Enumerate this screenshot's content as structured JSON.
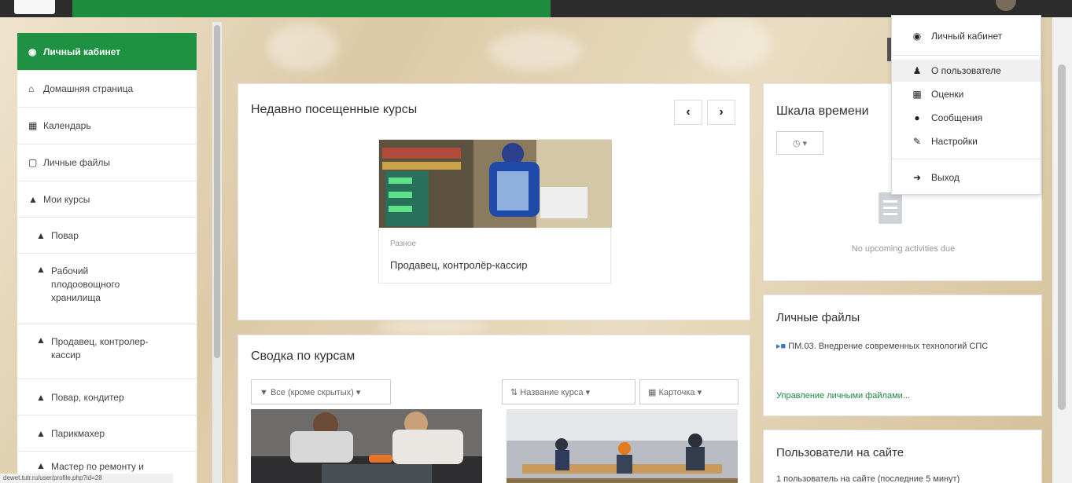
{
  "sidebar": {
    "items": [
      {
        "label": "Личный кабинет",
        "icon": "dashboard-icon",
        "active": true
      },
      {
        "label": "Домашняя страница",
        "icon": "home-icon"
      },
      {
        "label": "Календарь",
        "icon": "calendar-icon"
      },
      {
        "label": "Личные файлы",
        "icon": "file-icon"
      },
      {
        "label": "Мои курсы",
        "icon": "graduation-cap-icon"
      },
      {
        "label": "Повар",
        "icon": "graduation-cap-icon"
      },
      {
        "label": "Рабочий плодоовощного хранилища",
        "icon": "graduation-cap-icon"
      },
      {
        "label": "Продавец, контролер-кассир",
        "icon": "graduation-cap-icon"
      },
      {
        "label": "Повар, кондитер",
        "icon": "graduation-cap-icon"
      },
      {
        "label": "Парикмахер",
        "icon": "graduation-cap-icon"
      },
      {
        "label": "Мастер по ремонту и",
        "icon": "graduation-cap-icon"
      }
    ],
    "status_url": "dewet.tutr.ru/user/profile.php?id=28"
  },
  "recent": {
    "title": "Недавно посещенные курсы",
    "prev_icon": "chevron-left-icon",
    "next_icon": "chevron-right-icon",
    "course": {
      "category": "Разное",
      "name": "Продавец, контролёр-кассир"
    }
  },
  "overview": {
    "title": "Сводка по курсам",
    "filter_label": "▼ Все (кроме скрытых) ▾",
    "sort_label": "⇅ Название курса ▾",
    "view_label": "▦ Карточка ▾"
  },
  "timeline": {
    "title": "Шкала времени",
    "select_label": "◷ ▾",
    "empty_text": "No upcoming activities due"
  },
  "files": {
    "title": "Личные файлы",
    "entry": "ПМ.03. Внедрение современных технологий СПС",
    "manage_link": "Управление личными файлами..."
  },
  "online": {
    "title": "Пользователи на сайте",
    "text": "1 пользователь на сайте (последние 5 минут)"
  },
  "user_menu": {
    "items": [
      {
        "label": "Личный кабинет",
        "icon": "dashboard-icon"
      },
      {
        "label": "О пользователе",
        "icon": "user-icon"
      },
      {
        "label": "Оценки",
        "icon": "table-icon"
      },
      {
        "label": "Сообщения",
        "icon": "comment-icon"
      },
      {
        "label": "Настройки",
        "icon": "wrench-icon"
      },
      {
        "label": "Выход",
        "icon": "sign-out-icon"
      }
    ]
  },
  "colors": {
    "brand_green": "#1e9142",
    "link_green": "#1e8b3f",
    "topbar": "#2c2c2c"
  }
}
